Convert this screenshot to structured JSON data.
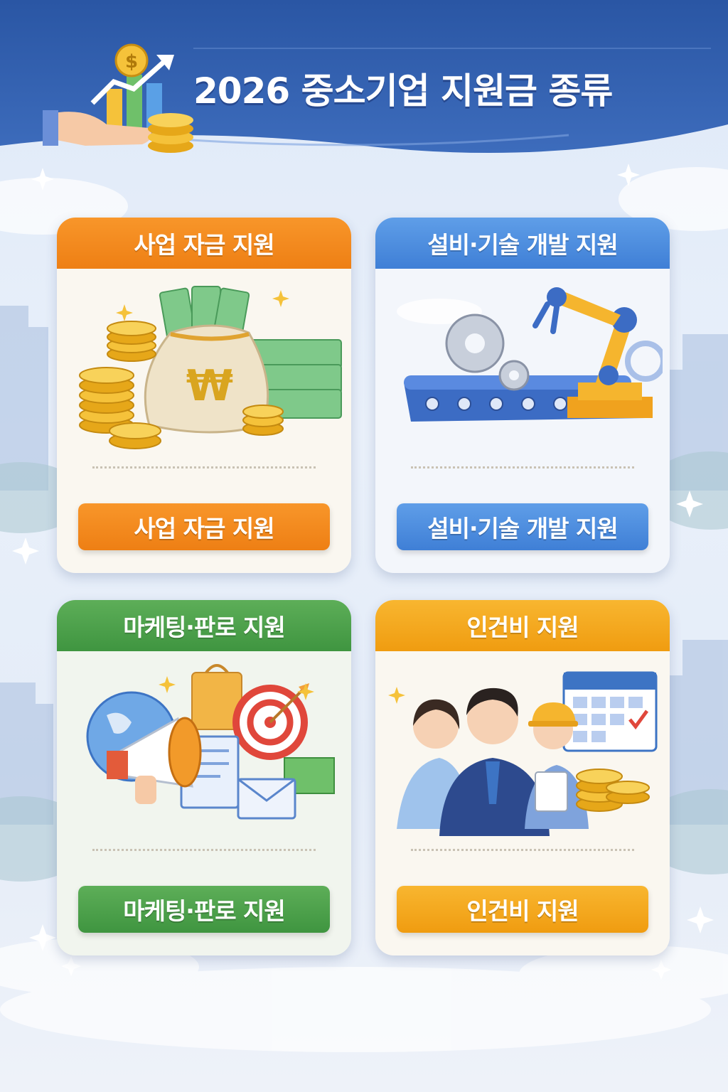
{
  "header": {
    "title": "2026 중소기업 지원금 종류"
  },
  "cards": [
    {
      "head_label": "사업 자금 지원",
      "button_label": "사업 자금 지원",
      "color": "#f08a1c",
      "art": "money-bag-coins-cash"
    },
    {
      "head_label": "설비·기술 개발 지원",
      "button_label": "설비·기술 개발 지원",
      "color": "#4a8ddd",
      "art": "robot-arm-gears-conveyor"
    },
    {
      "head_label": "마케팅·판로 지원",
      "button_label": "마케팅·판로 지원",
      "color": "#4aa14a",
      "art": "megaphone-globe-target"
    },
    {
      "head_label": "인건비 지원",
      "button_label": "인건비 지원",
      "color": "#f5a820",
      "art": "workers-calendar-coins"
    }
  ],
  "colors": {
    "header_blue": "#2d5aa8",
    "background": "#e4ecf8"
  }
}
